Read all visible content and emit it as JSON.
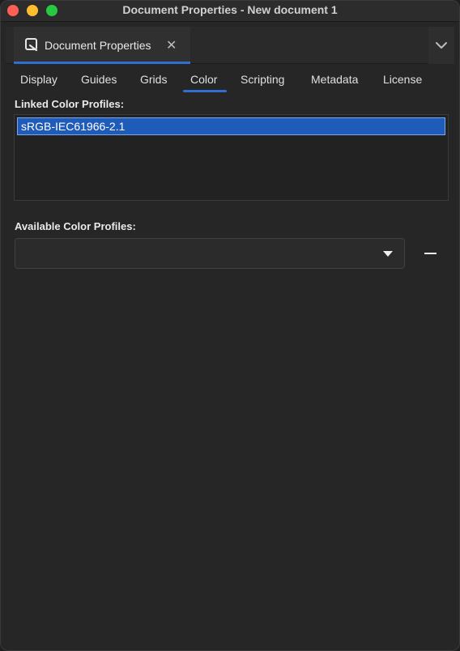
{
  "window": {
    "title": "Document Properties - New document 1"
  },
  "dock": {
    "tab_label": "Document Properties",
    "close_glyph": "✕",
    "logo_icon": "inkscape-document-icon",
    "menu_icon": "chevron-down-icon"
  },
  "tabs": [
    {
      "label": "Display"
    },
    {
      "label": "Guides"
    },
    {
      "label": "Grids"
    },
    {
      "label": "Color",
      "active": true
    },
    {
      "label": "Scripting"
    },
    {
      "label": "Metadata"
    },
    {
      "label": "License"
    }
  ],
  "color": {
    "linked_label": "Linked Color Profiles:",
    "linked_profiles": [
      "sRGB-IEC61966-2.1"
    ],
    "available_label": "Available Color Profiles:",
    "available_selected": "",
    "remove_icon": "minus-icon"
  },
  "colors": {
    "accent": "#2f6fd0",
    "selection": "#1f5bb8",
    "background": "#262626"
  }
}
